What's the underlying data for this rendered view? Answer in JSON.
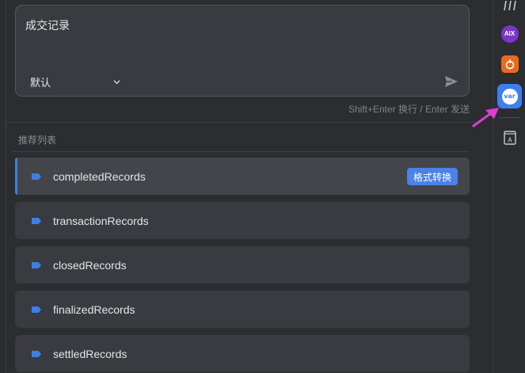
{
  "input": {
    "text": "成交记录",
    "model_selected": "默认"
  },
  "hint": "Shift+Enter 换行 / Enter 发送",
  "recommend": {
    "title": "推荐列表",
    "items": [
      {
        "label": "completedRecords",
        "active": true,
        "action_label": "格式转换"
      },
      {
        "label": "transactionRecords",
        "active": false
      },
      {
        "label": "closedRecords",
        "active": false
      },
      {
        "label": "finalizedRecords",
        "active": false
      },
      {
        "label": "settledRecords",
        "active": false
      }
    ]
  },
  "rail": {
    "ai_icon_text": "AIX",
    "var_icon_text": "var",
    "book_icon_letter": "A"
  },
  "colors": {
    "accent": "#3d7fe0",
    "tag_icon": "#3c7fe6",
    "ai_purple": "#7b35c9",
    "orange": "#e86a1f",
    "arrow": "#e03ccf"
  }
}
